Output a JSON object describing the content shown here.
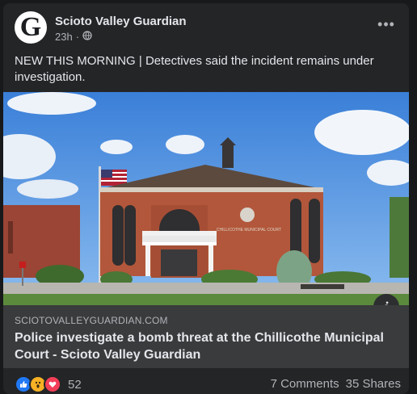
{
  "post": {
    "page_name": "Scioto Valley Guardian",
    "avatar_letter": "G",
    "time": "23h",
    "privacy_icon": "globe-icon",
    "text": "NEW THIS MORNING | Detectives said the incident remains under investigation."
  },
  "link": {
    "domain": "SCIOTOVALLEYGUARDIAN.COM",
    "title": "Police investigate a bomb threat at the Chillicothe Municipal Court - Scioto Valley Guardian",
    "image_text": "CHILLICOTHE MUNICIPAL COURT"
  },
  "engagement": {
    "reaction_count": "52",
    "reactions": [
      "like-reaction",
      "wow-reaction",
      "love-reaction"
    ],
    "comments": "7 Comments",
    "shares": "35 Shares"
  },
  "colors": {
    "background": "#18191a",
    "card": "#242526",
    "link_preview": "#3a3b3c",
    "primary_text": "#e4e6eb",
    "secondary_text": "#b0b3b8"
  }
}
